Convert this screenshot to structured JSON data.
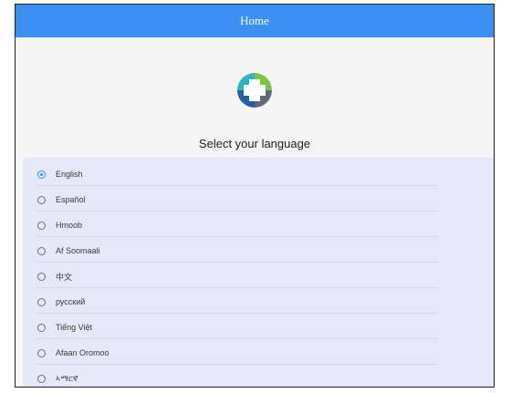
{
  "topbar": {
    "title": "Home"
  },
  "main": {
    "prompt": "Select your language"
  },
  "languages": [
    {
      "label": "English",
      "selected": true
    },
    {
      "label": "Español",
      "selected": false
    },
    {
      "label": "Hmoob",
      "selected": false
    },
    {
      "label": "Af Soomaali",
      "selected": false
    },
    {
      "label": "中文",
      "selected": false
    },
    {
      "label": "русский",
      "selected": false
    },
    {
      "label": "Tiếng Việt",
      "selected": false
    },
    {
      "label": "Afaan Oromoo",
      "selected": false
    },
    {
      "label": "ኣማርኛ",
      "selected": false
    }
  ],
  "colors": {
    "accent": "#3d8ef2",
    "list_background": "#e7e7fa",
    "page_background": "#f5f5f5"
  },
  "icons": {
    "logo": "health-cross-logo-icon"
  }
}
